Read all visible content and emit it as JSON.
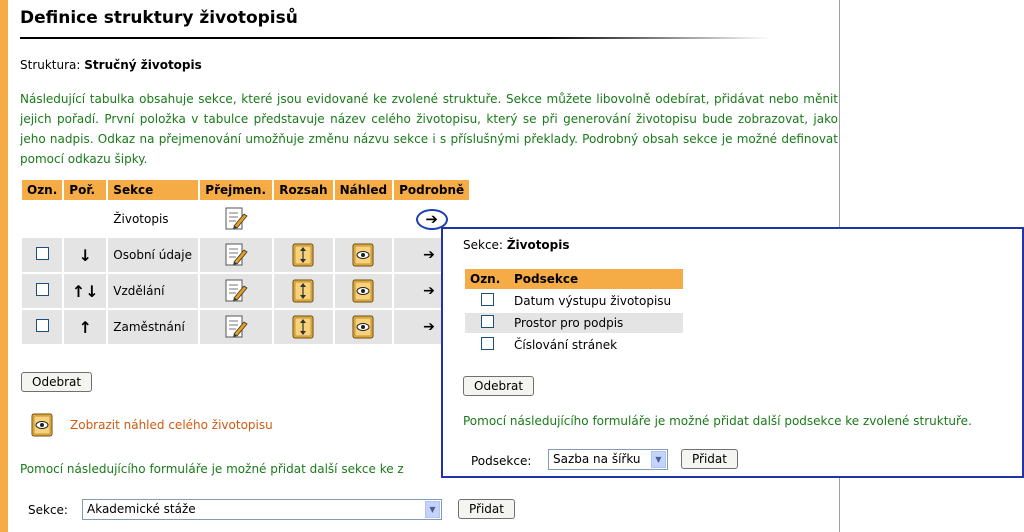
{
  "page": {
    "title": "Definice struktury životopisů",
    "structure_label": "Struktura:",
    "structure_value": "Stručný životopis",
    "intro": "Následující tabulka obsahuje sekce, které jsou evidované ke zvolené struktuře. Sekce můžete libovolně odebírat, přidávat nebo měnit jejich pořadí. První položka v tabulce představuje název celého životopisu, který se při generování životopisu bude zobrazovat, jako jeho nadpis. Odkaz na přejmenování umožňuje změnu názvu sekce i s příslušnými překlady. Podrobný obsah sekce je možné definovat pomocí odkazu šipky."
  },
  "table": {
    "headers": [
      "Ozn.",
      "Poř.",
      "Sekce",
      "Přejmen.",
      "Rozsah",
      "Náhled",
      "Podrobně"
    ],
    "rows": [
      {
        "name": "Životopis",
        "order": ""
      },
      {
        "name": "Osobní údaje",
        "order": "↓"
      },
      {
        "name": "Vzdělání",
        "order": "↑↓"
      },
      {
        "name": "Zaměstnání",
        "order": "↑"
      }
    ]
  },
  "buttons": {
    "remove": "Odebrat",
    "add": "Přidat",
    "popup_remove": "Odebrat",
    "popup_add": "Přidat"
  },
  "preview_link": "Zobrazit náhled celého životopisu",
  "form_note": "Pomocí následujícího formuláře je možné přidat další sekce ke z",
  "form": {
    "section_label": "Sekce:",
    "section_value": "Akademické stáže"
  },
  "popup": {
    "section_label": "Sekce:",
    "section_value": "Životopis",
    "headers": [
      "Ozn.",
      "Podsekce"
    ],
    "rows": [
      "Datum výstupu životopisu",
      "Prostor pro podpis",
      "Číslování stránek"
    ],
    "note": "Pomocí následujícího formuláře je možné přidat další podsekce ke zvolené struktuře.",
    "subsection_label": "Podsekce:",
    "subsection_value": "Sazba na šířku"
  },
  "icons": {
    "rename": "edit-document-icon",
    "range": "range-book-icon",
    "preview": "eye-book-icon",
    "detail": "right-arrow-icon"
  },
  "colors": {
    "accent": "#f5ab46",
    "green_text": "#1a7a1a",
    "link_orange": "#d05a10",
    "popup_border": "#2233aa"
  }
}
